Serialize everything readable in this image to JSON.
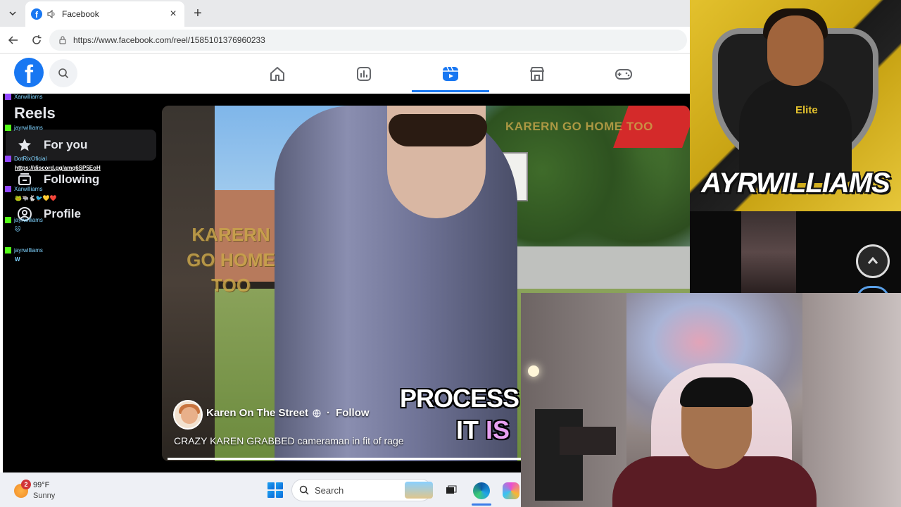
{
  "browser": {
    "tab_title": "Facebook",
    "url": "https://www.facebook.com/reel/1585101376960233"
  },
  "facebook": {
    "logo_letter": "f",
    "sidebar": {
      "heading": "Reels",
      "items": [
        {
          "label": "For you",
          "icon": "star-icon",
          "active": true
        },
        {
          "label": "Following",
          "icon": "inbox-icon",
          "active": false
        },
        {
          "label": "Profile",
          "icon": "person-icon",
          "active": false
        }
      ]
    },
    "reel": {
      "author": "Karen On The Street",
      "follow_label": "Follow",
      "separator": "·",
      "caption": "CRAZY KAREN GRABBED cameraman in fit of rage",
      "overlay_left": "KARERN GO HOME TOO",
      "overlay_top": "KARERN GO HOME TOO",
      "subtitle_line1": "PROCESS WI",
      "subtitle_line2a": "IT ",
      "subtitle_line2b": "IS",
      "progress": 1.0
    }
  },
  "chat": [
    {
      "user": "Xarwilliams",
      "msg": ""
    },
    {
      "user": "jayrwilliams",
      "msg": ""
    },
    {
      "user": "DotRixOficial",
      "msg": "https://discord.gg/amq6SP5EoH"
    },
    {
      "user": "Xarwilliams",
      "msg": "🐸🐃🐇🐦💛❤️"
    },
    {
      "user": "jayrwilliams",
      "msg": "🐱"
    },
    {
      "user": "jayrwilliams",
      "msg": "W"
    }
  ],
  "stream": {
    "channel_name": "AYRWILLIAMS",
    "sponsor": "Elite"
  },
  "taskbar": {
    "weather_temp": "99°F",
    "weather_cond": "Sunny",
    "notification_count": "2",
    "search_placeholder": "Search"
  },
  "colors": {
    "fb_blue": "#1877f2",
    "dark_bg": "#000000",
    "gold": "#e3c12d"
  }
}
